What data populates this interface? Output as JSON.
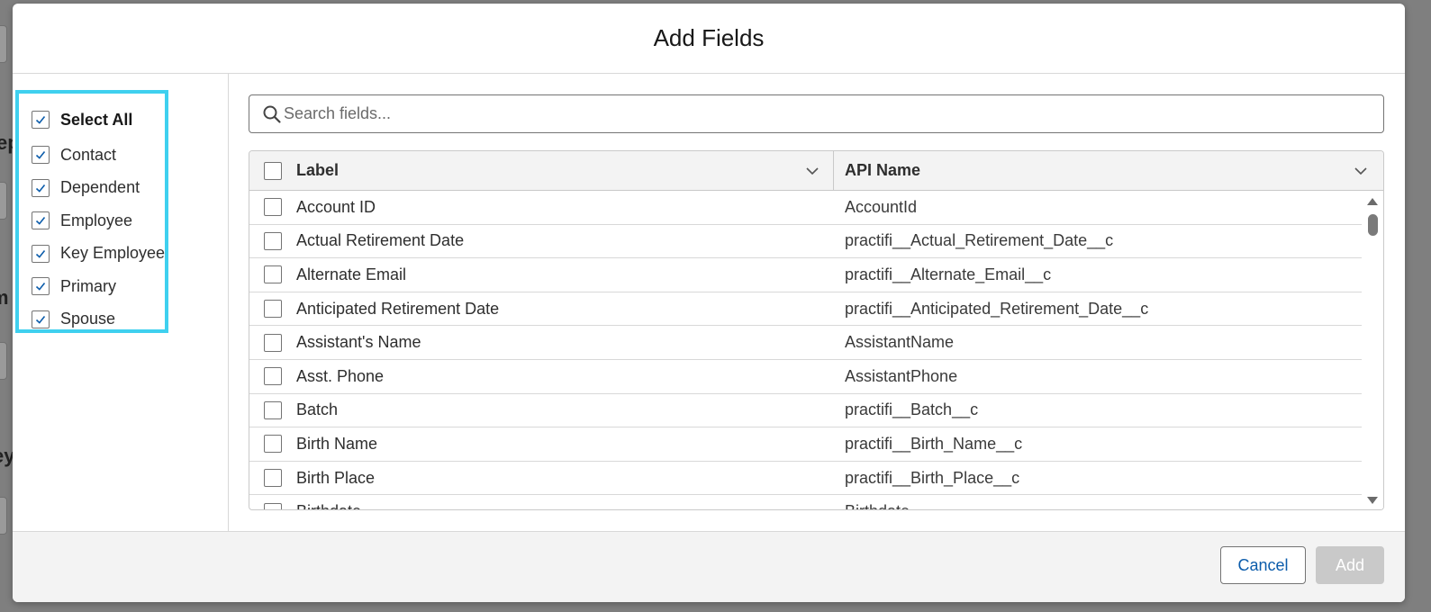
{
  "backdrop": {
    "fragments": [
      "ep",
      "m",
      "ey"
    ]
  },
  "modal": {
    "title": "Add Fields"
  },
  "filters": {
    "select_all_label": "Select All",
    "items": [
      {
        "label": "Contact",
        "checked": true
      },
      {
        "label": "Dependent",
        "checked": true
      },
      {
        "label": "Employee",
        "checked": true
      },
      {
        "label": "Key Employee",
        "checked": true
      },
      {
        "label": "Primary",
        "checked": true
      },
      {
        "label": "Spouse",
        "checked": true
      }
    ],
    "highlight_color": "#3fd0ef"
  },
  "search": {
    "placeholder": "Search fields..."
  },
  "table": {
    "columns": [
      "Label",
      "API Name"
    ],
    "rows": [
      {
        "label": "Account ID",
        "api": "AccountId"
      },
      {
        "label": "Actual Retirement Date",
        "api": "practifi__Actual_Retirement_Date__c"
      },
      {
        "label": "Alternate Email",
        "api": "practifi__Alternate_Email__c"
      },
      {
        "label": "Anticipated Retirement Date",
        "api": "practifi__Anticipated_Retirement_Date__c"
      },
      {
        "label": "Assistant's Name",
        "api": "AssistantName"
      },
      {
        "label": "Asst. Phone",
        "api": "AssistantPhone"
      },
      {
        "label": "Batch",
        "api": "practifi__Batch__c"
      },
      {
        "label": "Birth Name",
        "api": "practifi__Birth_Name__c"
      },
      {
        "label": "Birth Place",
        "api": "practifi__Birth_Place__c"
      },
      {
        "label": "Birthdate",
        "api": "Birthdate"
      }
    ]
  },
  "footer": {
    "cancel_label": "Cancel",
    "add_label": "Add"
  },
  "colors": {
    "brand_link": "#0b5cab",
    "disabled_button": "#c9c9c9"
  }
}
